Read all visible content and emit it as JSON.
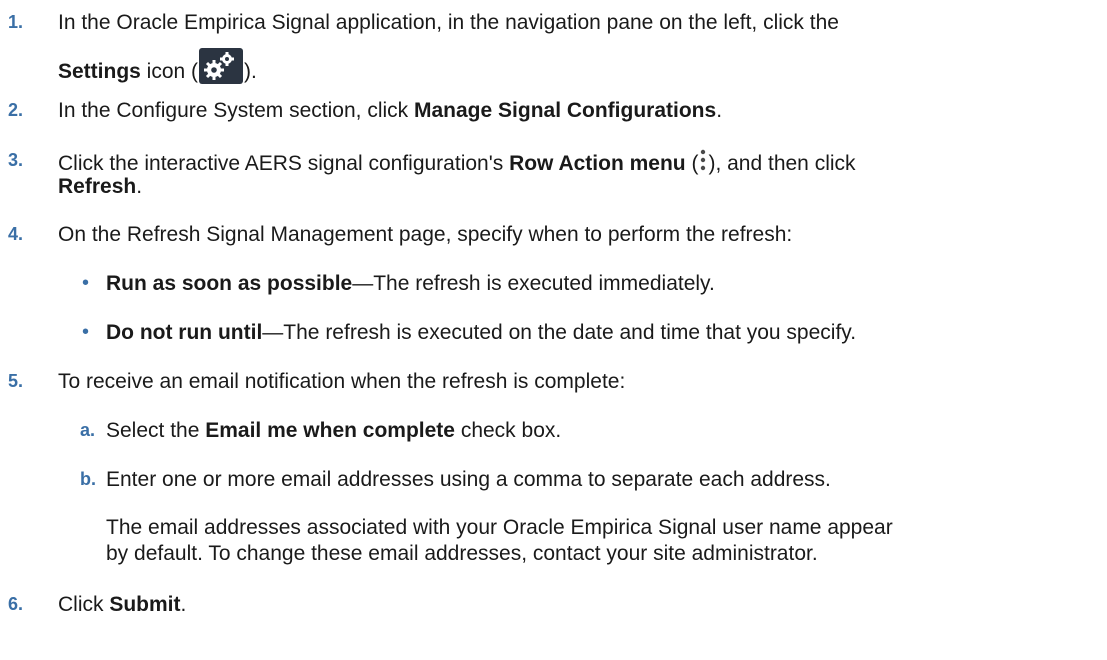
{
  "steps": [
    {
      "num": "1.",
      "pre": "In the Oracle Empirica Signal application, in the navigation pane on the left, click the",
      "bold": "Settings",
      "post_a": " icon (",
      "post_b": ")."
    },
    {
      "num": "2.",
      "pre": "In the Configure System section, click ",
      "bold": "Manage Signal Configurations",
      "post": "."
    },
    {
      "num": "3.",
      "pre": "Click the interactive AERS signal configuration's ",
      "bold": "Row Action menu",
      "mid_a": " (",
      "mid_b": "), and then click",
      "bold2": "Refresh",
      "post": "."
    },
    {
      "num": "4.",
      "text": "On the Refresh Signal Management page, specify when to perform the refresh:",
      "bullets": [
        {
          "bold": "Run as soon as possible",
          "text": "—The refresh is executed immediately."
        },
        {
          "bold": "Do not run until",
          "text": "—The refresh is executed on the date and time that you specify."
        }
      ]
    },
    {
      "num": "5.",
      "text": "To receive an email notification when the refresh is complete:",
      "substeps": [
        {
          "letter": "a.",
          "pre": "Select the ",
          "bold": "Email me when complete",
          "post": " check box."
        },
        {
          "letter": "b.",
          "text": "Enter one or more email addresses using a comma to separate each address.",
          "note_line1": "The email addresses associated with your Oracle Empirica Signal user name appear",
          "note_line2": "by default. To change these email addresses, contact your site administrator."
        }
      ]
    },
    {
      "num": "6.",
      "pre": "Click ",
      "bold": "Submit",
      "post": "."
    }
  ],
  "icons": {
    "settings": "gear-icon",
    "row_action": "kebab-icon"
  }
}
